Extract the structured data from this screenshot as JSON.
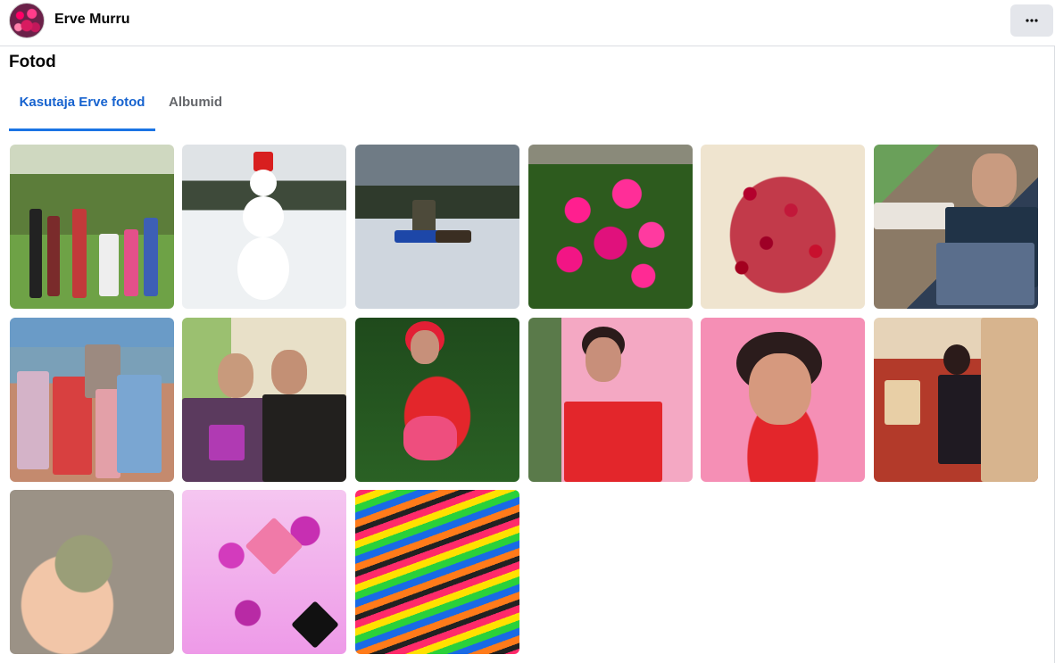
{
  "header": {
    "user_name": "Erve Murru",
    "more_icon": "more-options-icon"
  },
  "page": {
    "title": "Fotod"
  },
  "tabs": [
    {
      "label": "Kasutaja Erve fotod",
      "active": true
    },
    {
      "label": "Albumid",
      "active": false
    }
  ],
  "colors": {
    "accent": "#1877f2",
    "tab_active_text": "#1763cf",
    "button_bg": "#e4e6eb"
  }
}
